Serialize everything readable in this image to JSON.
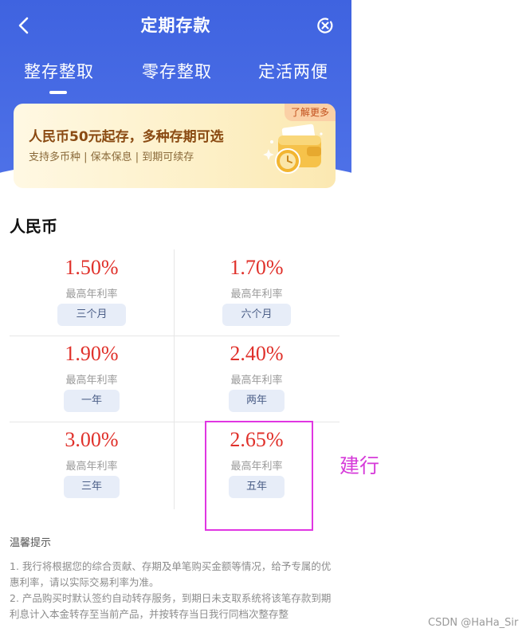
{
  "header": {
    "title": "定期存款",
    "tabs": [
      {
        "label": "整存整取",
        "active": true
      },
      {
        "label": "零存整取",
        "active": false
      },
      {
        "label": "定活两便",
        "active": false
      }
    ],
    "icons": {
      "back": "chevron-left-icon",
      "close": "close-circle-icon"
    }
  },
  "banner": {
    "title": "人民币50元起存，多种存期可选",
    "subtitle": "支持多币种 | 保本保息 | 到期可续存",
    "learn_more": "了解更多"
  },
  "section_title": "人民币",
  "rates": [
    {
      "rate": "1.50%",
      "label": "最高年利率",
      "term": "三个月"
    },
    {
      "rate": "1.70%",
      "label": "最高年利率",
      "term": "六个月"
    },
    {
      "rate": "1.90%",
      "label": "最高年利率",
      "term": "一年"
    },
    {
      "rate": "2.40%",
      "label": "最高年利率",
      "term": "两年"
    },
    {
      "rate": "3.00%",
      "label": "最高年利率",
      "term": "三年"
    },
    {
      "rate": "2.65%",
      "label": "最高年利率",
      "term": "五年"
    }
  ],
  "annotation": "建行",
  "tips": {
    "title": "温馨提示",
    "items": [
      "1. 我行将根据您的综合贡献、存期及单笔购买金额等情况，给予专属的优惠利率，请以实际交易利率为准。",
      "2. 产品购买时默认签约自动转存服务，到期日未支取系统将该笔存款到期利息计入本金转存至当前产品，并按转存当日我行同档次整存整"
    ]
  },
  "watermark": "CSDN @HaHa_Sir",
  "colors": {
    "header": "#4169e1",
    "rate": "#e0312b",
    "highlight": "#e036e2"
  }
}
